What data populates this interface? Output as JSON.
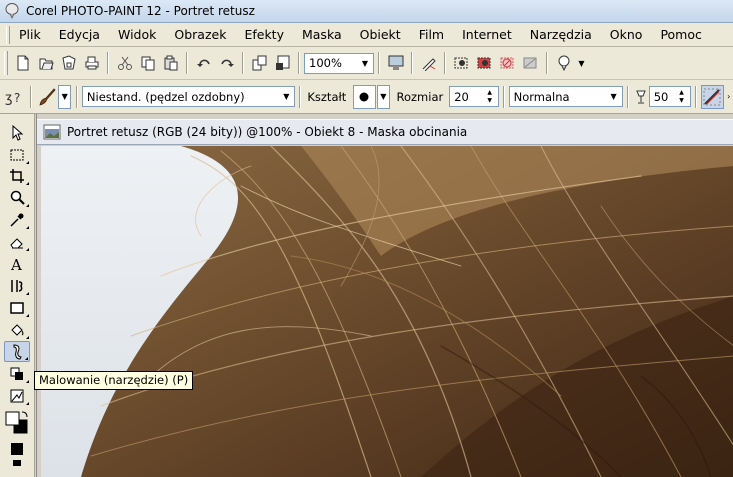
{
  "window": {
    "title": "Corel PHOTO-PAINT 12 - Portret retusz",
    "app_icon": "corel-balloon-icon"
  },
  "menu": {
    "items": [
      {
        "label": "Plik"
      },
      {
        "label": "Edycja"
      },
      {
        "label": "Widok"
      },
      {
        "label": "Obrazek"
      },
      {
        "label": "Efekty"
      },
      {
        "label": "Maska"
      },
      {
        "label": "Obiekt"
      },
      {
        "label": "Film"
      },
      {
        "label": "Internet"
      },
      {
        "label": "Narzędzia"
      },
      {
        "label": "Okno"
      },
      {
        "label": "Pomoc"
      }
    ]
  },
  "toolbar_standard": {
    "zoom": "100%",
    "icons": [
      "new-icon",
      "open-icon",
      "save-icon",
      "print-icon",
      "cut-icon",
      "copy-icon",
      "paste-icon",
      "undo-icon",
      "redo-icon",
      "import-icon",
      "export-icon",
      "zoom-combo",
      "full-screen-icon",
      "pen-icon",
      "mask-visible-icon",
      "mask-marquee-icon",
      "mask-off-icon",
      "mask-overlay-icon",
      "corel-launch-icon"
    ]
  },
  "property_bar": {
    "brush_type": "Niestand. (pędzel ozdobny)",
    "shape_label": "Kształt",
    "size_label": "Rozmiar",
    "size_value": "20",
    "merge_mode": "Normalna",
    "transparency_value": "50"
  },
  "toolbox": {
    "tools": [
      "pick-tool",
      "mask-rectangle-tool",
      "crop-tool",
      "zoom-tool",
      "eyedropper-tool",
      "eraser-tool",
      "text-tool",
      "effect-tool",
      "rectangle-tool",
      "fill-tool",
      "paint-tool",
      "object-tool",
      "image-sprayer-tool",
      "color-swatch"
    ],
    "active": "paint-tool"
  },
  "document": {
    "title": "Portret retusz (RGB (24 bity)) @100% - Obiekt 8 - Maska obcinania"
  },
  "tooltip": {
    "text": "Malowanie (narzędzie) (P)"
  },
  "colors": {
    "background": "#ece9d8",
    "canvas_bg": "#e2e6ec",
    "hair_dark": "#5a3c22",
    "hair_light": "#c9a878"
  }
}
